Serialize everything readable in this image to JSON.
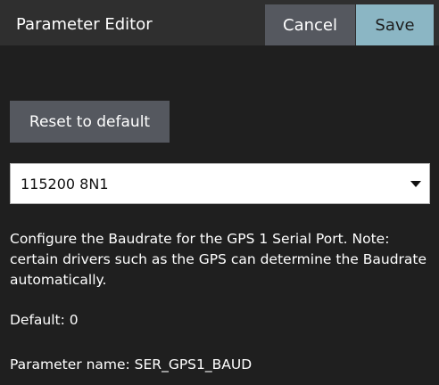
{
  "header": {
    "title": "Parameter Editor",
    "cancel_label": "Cancel",
    "save_label": "Save"
  },
  "reset": {
    "label": "Reset to default"
  },
  "value_select": {
    "selected": "115200 8N1"
  },
  "description": "Configure the Baudrate for the GPS 1 Serial Port. Note: certain drivers such as the GPS can determine the Baudrate automatically.",
  "default_text": "Default: 0",
  "parameter_name_text": "Parameter name: SER_GPS1_BAUD",
  "colors": {
    "background": "#1f1f1f",
    "header": "#2f2f2f",
    "button": "#55585f",
    "save_accent": "#8bb6c4",
    "input_background": "#ffffff"
  },
  "icons": {
    "dropdown": "chevron-down-icon"
  }
}
